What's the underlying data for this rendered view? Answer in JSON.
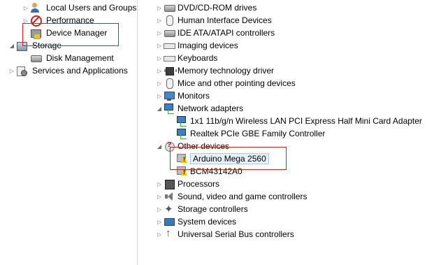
{
  "left_tree": {
    "local_users": "Local Users and Groups",
    "performance": "Performance",
    "device_manager": "Device Manager",
    "storage": "Storage",
    "disk_management": "Disk Management",
    "services": "Services and Applications"
  },
  "device_tree": {
    "dvd": "DVD/CD-ROM drives",
    "hid": "Human Interface Devices",
    "ide": "IDE ATA/ATAPI controllers",
    "imaging": "Imaging devices",
    "keyboards": "Keyboards",
    "memory": "Memory technology driver",
    "mice": "Mice and other pointing devices",
    "monitors": "Monitors",
    "network": "Network adapters",
    "network_children": [
      "1x1 11b/g/n Wireless LAN PCI Express Half Mini Card Adapter",
      "Realtek PCIe GBE Family Controller"
    ],
    "other": "Other devices",
    "other_children": [
      "Arduino Mega 2560",
      "BCM43142A0"
    ],
    "processors": "Processors",
    "sound": "Sound, video and game controllers",
    "storage_ctrl": "Storage controllers",
    "system": "System devices",
    "usb": "Universal Serial Bus controllers"
  },
  "colors": {
    "highlight_box": "#e02020",
    "selection": "#e8f1fb"
  }
}
